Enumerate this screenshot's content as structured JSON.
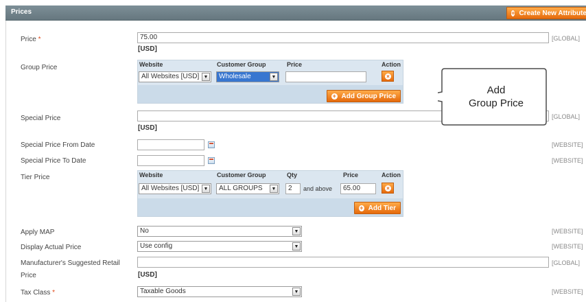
{
  "header": {
    "title": "Prices",
    "create_button": "Create New Attribute"
  },
  "fields": {
    "price": {
      "label": "Price",
      "required_mark": "*",
      "value": "75.00",
      "currency": "[USD]",
      "scope": "[GLOBAL]"
    },
    "group_price": {
      "label": "Group Price",
      "headers": {
        "website": "Website",
        "customer_group": "Customer Group",
        "price": "Price",
        "action": "Action"
      },
      "row": {
        "website": "All Websites [USD]",
        "customer_group": "Wholesale",
        "price": ""
      },
      "add_button": "Add Group Price"
    },
    "special_price": {
      "label": "Special Price",
      "value": "",
      "currency": "[USD]",
      "scope": "[GLOBAL]"
    },
    "special_from": {
      "label": "Special Price From Date",
      "value": "",
      "scope": "[WEBSITE]"
    },
    "special_to": {
      "label": "Special Price To Date",
      "value": "",
      "scope": "[WEBSITE]"
    },
    "tier_price": {
      "label": "Tier Price",
      "headers": {
        "website": "Website",
        "customer_group": "Customer Group",
        "qty": "Qty",
        "price": "Price",
        "action": "Action"
      },
      "row": {
        "website": "All Websites [USD]",
        "customer_group": "ALL GROUPS",
        "qty": "2",
        "and_above": "and above",
        "price": "65.00"
      },
      "add_button": "Add Tier"
    },
    "apply_map": {
      "label": "Apply MAP",
      "value": "No",
      "scope": "[WEBSITE]"
    },
    "display_actual": {
      "label": "Display Actual Price",
      "value": "Use config",
      "scope": "[WEBSITE]"
    },
    "msrp": {
      "label_line1": "Manufacturer's Suggested Retail",
      "label_line2": "Price",
      "value": "",
      "currency": "[USD]",
      "scope": "[GLOBAL]"
    },
    "tax_class": {
      "label": "Tax Class",
      "required_mark": "*",
      "value": "Taxable Goods",
      "scope": "[WEBSITE]"
    }
  },
  "callout": {
    "line1": "Add",
    "line2": "Group Price"
  },
  "icons": {
    "add": "plus-circle-icon",
    "delete": "x-circle-icon",
    "calendar": "calendar-icon",
    "dropdown": "chevron-down-icon"
  },
  "colors": {
    "header_bg": "#6f8189",
    "button_orange": "#f18200",
    "grid_bg": "#dbe6f0",
    "scope_gray": "#8a8a8a"
  }
}
